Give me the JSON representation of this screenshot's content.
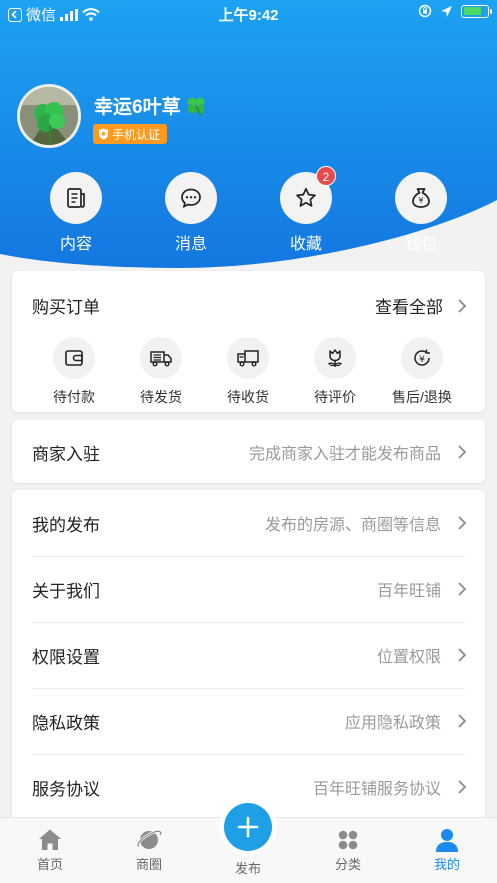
{
  "status_bar": {
    "carrier": "微信",
    "time": "上午9:42",
    "battery_percent": 75
  },
  "profile": {
    "username": "幸运6叶草",
    "badge": "手机认证"
  },
  "quick_actions": [
    {
      "label": "内容",
      "icon": "content-icon"
    },
    {
      "label": "消息",
      "icon": "message-icon"
    },
    {
      "label": "收藏",
      "icon": "star-icon",
      "badge": "2"
    },
    {
      "label": "钱包",
      "icon": "wallet-icon"
    }
  ],
  "orders": {
    "title": "购买订单",
    "view_all": "查看全部",
    "items": [
      {
        "label": "待付款",
        "icon": "wallet-card-icon"
      },
      {
        "label": "待发货",
        "icon": "shipping-icon"
      },
      {
        "label": "待收货",
        "icon": "truck-icon"
      },
      {
        "label": "待评价",
        "icon": "flower-icon"
      },
      {
        "label": "售后/退换",
        "icon": "refund-icon"
      }
    ]
  },
  "merchant": {
    "title": "商家入驻",
    "subtitle": "完成商家入驻才能发布商品"
  },
  "menu": [
    {
      "title": "我的发布",
      "subtitle": "发布的房源、商圈等信息"
    },
    {
      "title": "关于我们",
      "subtitle": "百年旺铺"
    },
    {
      "title": "权限设置",
      "subtitle": "位置权限"
    },
    {
      "title": "隐私政策",
      "subtitle": "应用隐私政策"
    },
    {
      "title": "服务协议",
      "subtitle": "百年旺铺服务协议"
    }
  ],
  "tabbar": {
    "tabs": [
      {
        "label": "首页",
        "icon": "home-icon"
      },
      {
        "label": "商圈",
        "icon": "planet-icon"
      },
      {
        "label": "发布",
        "icon": "plus-icon"
      },
      {
        "label": "分类",
        "icon": "grid-icon"
      },
      {
        "label": "我的",
        "icon": "user-icon",
        "active": true
      }
    ]
  },
  "colors": {
    "hero_top": "#1da2f2",
    "hero_bottom": "#1477e0",
    "accent": "#1a8cf0",
    "badge_orange": "#ff9a1f",
    "red_badge": "#e74a4a"
  }
}
